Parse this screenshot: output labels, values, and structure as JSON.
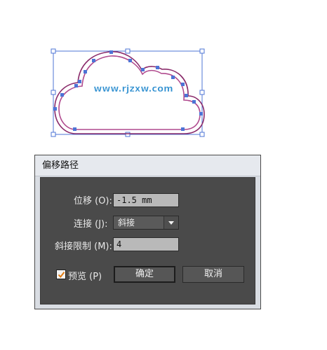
{
  "artwork": {
    "watermark_text": "www.rjzxw.com",
    "colors": {
      "outline_outer": "#8a2a6a",
      "outline_inner": "#b04a8e",
      "selection": "#4d74d6",
      "watermark_fill": "#2f8fd0",
      "watermark_stroke": "#ffffff"
    }
  },
  "dialog": {
    "title": "偏移路径",
    "offset_label": "位移 (O):",
    "offset_value": "-1.5 mm",
    "join_label": "连接 (J):",
    "join_value": "斜接",
    "miter_label": "斜接限制 (M):",
    "miter_value": "4",
    "preview_label": "预览 (P)",
    "preview_checked": true,
    "ok_label": "确定",
    "cancel_label": "取消",
    "colors": {
      "body_bg": "#4a4a4a",
      "checkmark": "#e07a10"
    }
  }
}
